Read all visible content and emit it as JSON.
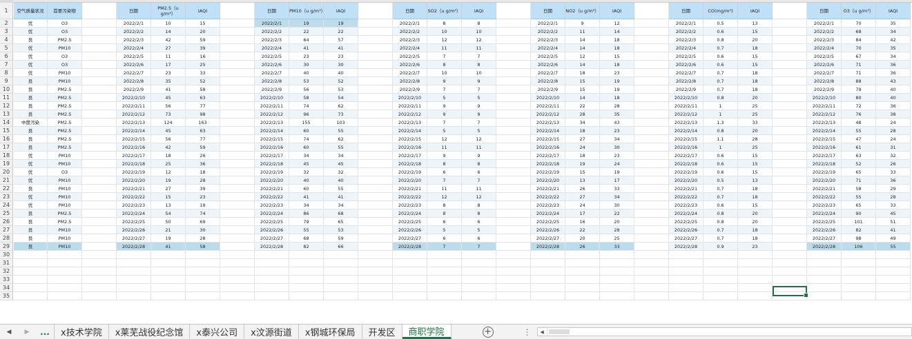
{
  "sheet": {
    "row_numbers": [
      "1",
      "2",
      "3",
      "4",
      "5",
      "6",
      "7",
      "8",
      "9",
      "10",
      "11",
      "12",
      "13",
      "14",
      "15",
      "16",
      "17",
      "18",
      "19",
      "20",
      "21",
      "22",
      "23",
      "24",
      "25",
      "26",
      "27",
      "28",
      "29",
      "30",
      "31",
      "32",
      "33",
      "34",
      "35"
    ],
    "headers": [
      "空气质量状况",
      "首要污染物",
      "",
      "日期",
      "PM2.5（u g/m³）",
      "IAQI",
      "",
      "日期",
      "PM10（u g/m³）",
      "IAQI",
      "",
      "日期",
      "SO2（u g/m³）",
      "IAQI",
      "",
      "日期",
      "NO2（u g/m³）",
      "IAQI",
      "",
      "日期",
      "CO(mg/m³)",
      "IAQI",
      "",
      "日期",
      "O3（u g/m³）",
      "IAQI"
    ],
    "rows": [
      [
        "优",
        "O3",
        "",
        "2022/2/1",
        "10",
        "15",
        "",
        "2022/2/1",
        "19",
        "19",
        "",
        "2022/2/1",
        "8",
        "8",
        "",
        "2022/2/1",
        "9",
        "12",
        "",
        "2022/2/1",
        "0.5",
        "13",
        "",
        "2022/2/1",
        "70",
        "35"
      ],
      [
        "优",
        "O3",
        "",
        "2022/2/2",
        "14",
        "20",
        "",
        "2022/2/2",
        "22",
        "22",
        "",
        "2022/2/2",
        "10",
        "10",
        "",
        "2022/2/2",
        "11",
        "14",
        "",
        "2022/2/2",
        "0.6",
        "15",
        "",
        "2022/2/2",
        "68",
        "34"
      ],
      [
        "良",
        "PM2.5",
        "",
        "2022/2/3",
        "42",
        "59",
        "",
        "2022/2/3",
        "64",
        "57",
        "",
        "2022/2/3",
        "12",
        "12",
        "",
        "2022/2/3",
        "14",
        "18",
        "",
        "2022/2/3",
        "0.8",
        "20",
        "",
        "2022/2/3",
        "84",
        "42"
      ],
      [
        "优",
        "PM10",
        "",
        "2022/2/4",
        "27",
        "39",
        "",
        "2022/2/4",
        "41",
        "41",
        "",
        "2022/2/4",
        "11",
        "11",
        "",
        "2022/2/4",
        "14",
        "18",
        "",
        "2022/2/4",
        "0.7",
        "18",
        "",
        "2022/2/4",
        "70",
        "35"
      ],
      [
        "优",
        "O3",
        "",
        "2022/2/5",
        "11",
        "16",
        "",
        "2022/2/5",
        "23",
        "23",
        "",
        "2022/2/5",
        "7",
        "7",
        "",
        "2022/2/5",
        "12",
        "15",
        "",
        "2022/2/5",
        "0.6",
        "15",
        "",
        "2022/2/5",
        "67",
        "34"
      ],
      [
        "优",
        "O3",
        "",
        "2022/2/6",
        "17",
        "25",
        "",
        "2022/2/6",
        "30",
        "30",
        "",
        "2022/2/6",
        "8",
        "8",
        "",
        "2022/2/6",
        "14",
        "18",
        "",
        "2022/2/6",
        "0.6",
        "15",
        "",
        "2022/2/6",
        "71",
        "36"
      ],
      [
        "优",
        "PM10",
        "",
        "2022/2/7",
        "23",
        "33",
        "",
        "2022/2/7",
        "40",
        "40",
        "",
        "2022/2/7",
        "10",
        "10",
        "",
        "2022/2/7",
        "18",
        "23",
        "",
        "2022/2/7",
        "0.7",
        "18",
        "",
        "2022/2/7",
        "71",
        "36"
      ],
      [
        "良",
        "PM10",
        "",
        "2022/2/8",
        "35",
        "52",
        "",
        "2022/2/8",
        "53",
        "52",
        "",
        "2022/2/8",
        "9",
        "9",
        "",
        "2022/2/8",
        "15",
        "19",
        "",
        "2022/2/8",
        "0.7",
        "18",
        "",
        "2022/2/8",
        "88",
        "43"
      ],
      [
        "良",
        "PM2.5",
        "",
        "2022/2/9",
        "41",
        "58",
        "",
        "2022/2/9",
        "56",
        "53",
        "",
        "2022/2/9",
        "7",
        "7",
        "",
        "2022/2/9",
        "15",
        "19",
        "",
        "2022/2/9",
        "0.7",
        "18",
        "",
        "2022/2/9",
        "79",
        "40"
      ],
      [
        "良",
        "PM2.5",
        "",
        "2022/2/10",
        "45",
        "63",
        "",
        "2022/2/10",
        "58",
        "54",
        "",
        "2022/2/10",
        "5",
        "5",
        "",
        "2022/2/10",
        "14",
        "18",
        "",
        "2022/2/10",
        "0.8",
        "20",
        "",
        "2022/2/10",
        "80",
        "40"
      ],
      [
        "良",
        "PM2.5",
        "",
        "2022/2/11",
        "56",
        "77",
        "",
        "2022/2/11",
        "74",
        "62",
        "",
        "2022/2/11",
        "9",
        "9",
        "",
        "2022/2/11",
        "22",
        "28",
        "",
        "2022/2/11",
        "1",
        "25",
        "",
        "2022/2/11",
        "72",
        "36"
      ],
      [
        "良",
        "PM2.5",
        "",
        "2022/2/12",
        "73",
        "98",
        "",
        "2022/2/12",
        "96",
        "73",
        "",
        "2022/2/12",
        "9",
        "9",
        "",
        "2022/2/12",
        "28",
        "35",
        "",
        "2022/2/12",
        "1",
        "25",
        "",
        "2022/2/12",
        "76",
        "38"
      ],
      [
        "中度污染",
        "PM2.5",
        "",
        "2022/2/13",
        "124",
        "163",
        "",
        "2022/2/13",
        "155",
        "103",
        "",
        "2022/2/13",
        "7",
        "7",
        "",
        "2022/2/13",
        "34",
        "43",
        "",
        "2022/2/13",
        "1.3",
        "33",
        "",
        "2022/2/13",
        "48",
        "24"
      ],
      [
        "良",
        "PM2.5",
        "",
        "2022/2/14",
        "45",
        "63",
        "",
        "2022/2/14",
        "60",
        "55",
        "",
        "2022/2/14",
        "5",
        "5",
        "",
        "2022/2/14",
        "18",
        "23",
        "",
        "2022/2/14",
        "0.8",
        "20",
        "",
        "2022/2/14",
        "55",
        "28"
      ],
      [
        "良",
        "PM2.5",
        "",
        "2022/2/15",
        "56",
        "77",
        "",
        "2022/2/15",
        "74",
        "62",
        "",
        "2022/2/15",
        "12",
        "12",
        "",
        "2022/2/15",
        "27",
        "34",
        "",
        "2022/2/15",
        "1.1",
        "28",
        "",
        "2022/2/15",
        "47",
        "24"
      ],
      [
        "良",
        "PM2.5",
        "",
        "2022/2/16",
        "42",
        "59",
        "",
        "2022/2/16",
        "60",
        "55",
        "",
        "2022/2/16",
        "11",
        "11",
        "",
        "2022/2/16",
        "24",
        "30",
        "",
        "2022/2/16",
        "1",
        "25",
        "",
        "2022/2/16",
        "61",
        "31"
      ],
      [
        "优",
        "PM10",
        "",
        "2022/2/17",
        "18",
        "26",
        "",
        "2022/2/17",
        "34",
        "34",
        "",
        "2022/2/17",
        "9",
        "9",
        "",
        "2022/2/17",
        "18",
        "23",
        "",
        "2022/2/17",
        "0.6",
        "15",
        "",
        "2022/2/17",
        "63",
        "32"
      ],
      [
        "优",
        "PM10",
        "",
        "2022/2/18",
        "25",
        "36",
        "",
        "2022/2/18",
        "45",
        "45",
        "",
        "2022/2/18",
        "8",
        "8",
        "",
        "2022/2/18",
        "19",
        "24",
        "",
        "2022/2/18",
        "0.6",
        "15",
        "",
        "2022/2/18",
        "52",
        "26"
      ],
      [
        "优",
        "O3",
        "",
        "2022/2/19",
        "12",
        "18",
        "",
        "2022/2/19",
        "32",
        "32",
        "",
        "2022/2/19",
        "6",
        "6",
        "",
        "2022/2/19",
        "15",
        "19",
        "",
        "2022/2/19",
        "0.6",
        "15",
        "",
        "2022/2/19",
        "65",
        "33"
      ],
      [
        "优",
        "PM10",
        "",
        "2022/2/20",
        "19",
        "28",
        "",
        "2022/2/20",
        "40",
        "40",
        "",
        "2022/2/20",
        "7",
        "7",
        "",
        "2022/2/20",
        "13",
        "17",
        "",
        "2022/2/20",
        "0.5",
        "13",
        "",
        "2022/2/20",
        "71",
        "36"
      ],
      [
        "良",
        "PM10",
        "",
        "2022/2/21",
        "27",
        "39",
        "",
        "2022/2/21",
        "60",
        "55",
        "",
        "2022/2/21",
        "11",
        "11",
        "",
        "2022/2/21",
        "26",
        "33",
        "",
        "2022/2/21",
        "0.7",
        "18",
        "",
        "2022/2/21",
        "58",
        "29"
      ],
      [
        "优",
        "PM10",
        "",
        "2022/2/22",
        "15",
        "23",
        "",
        "2022/2/22",
        "41",
        "41",
        "",
        "2022/2/22",
        "12",
        "12",
        "",
        "2022/2/22",
        "27",
        "34",
        "",
        "2022/2/22",
        "0.7",
        "18",
        "",
        "2022/2/22",
        "55",
        "28"
      ],
      [
        "优",
        "PM10",
        "",
        "2022/2/23",
        "13",
        "19",
        "",
        "2022/2/23",
        "34",
        "34",
        "",
        "2022/2/23",
        "8",
        "8",
        "",
        "2022/2/23",
        "24",
        "30",
        "",
        "2022/2/23",
        "0.6",
        "15",
        "",
        "2022/2/23",
        "65",
        "33"
      ],
      [
        "良",
        "PM2.5",
        "",
        "2022/2/24",
        "54",
        "74",
        "",
        "2022/2/24",
        "86",
        "68",
        "",
        "2022/2/24",
        "8",
        "8",
        "",
        "2022/2/24",
        "17",
        "22",
        "",
        "2022/2/24",
        "0.8",
        "20",
        "",
        "2022/2/24",
        "90",
        "45"
      ],
      [
        "良",
        "PM2.5",
        "",
        "2022/2/25",
        "50",
        "69",
        "",
        "2022/2/25",
        "79",
        "65",
        "",
        "2022/2/25",
        "6",
        "6",
        "",
        "2022/2/25",
        "16",
        "20",
        "",
        "2022/2/25",
        "0.8",
        "20",
        "",
        "2022/2/25",
        "101",
        "51"
      ],
      [
        "良",
        "PM10",
        "",
        "2022/2/26",
        "21",
        "30",
        "",
        "2022/2/26",
        "55",
        "53",
        "",
        "2022/2/26",
        "5",
        "5",
        "",
        "2022/2/26",
        "22",
        "28",
        "",
        "2022/2/26",
        "0.7",
        "18",
        "",
        "2022/2/26",
        "82",
        "41"
      ],
      [
        "良",
        "PM10",
        "",
        "2022/2/27",
        "19",
        "28",
        "",
        "2022/2/27",
        "68",
        "59",
        "",
        "2022/2/27",
        "6",
        "6",
        "",
        "2022/2/27",
        "20",
        "25",
        "",
        "2022/2/27",
        "0.7",
        "18",
        "",
        "2022/2/27",
        "98",
        "49"
      ],
      [
        "良",
        "PM10",
        "",
        "2022/2/28",
        "41",
        "58",
        "",
        "2022/2/28",
        "82",
        "66",
        "",
        "2022/2/28",
        "7",
        "7",
        "",
        "2022/2/28",
        "26",
        "33",
        "",
        "2022/2/28",
        "0.9",
        "23",
        "",
        "2022/2/28",
        "106",
        "55"
      ]
    ]
  },
  "tabbar": {
    "nav_prev": "◀",
    "nav_next": "▶",
    "ellipsis": "...",
    "tabs": [
      "x技术学院",
      "x莱芜战役纪念馆",
      "x泰兴公司",
      "x汶源街道",
      "x钢城环保局",
      "开发区",
      "商职学院"
    ],
    "active_tab": "商职学院",
    "add_sheet": "+",
    "more": "⋮",
    "scroll_left": "◀"
  }
}
